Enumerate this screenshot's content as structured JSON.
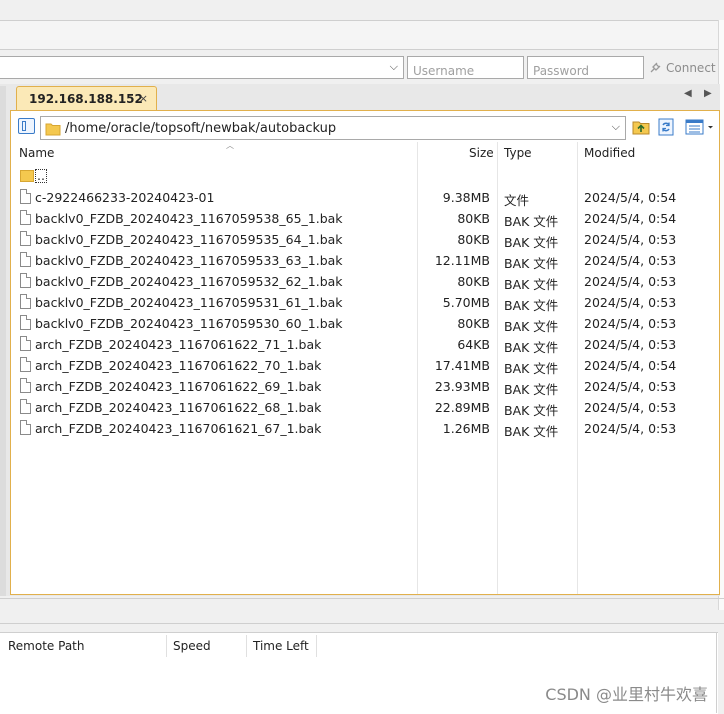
{
  "quickconnect": {
    "host_value": "",
    "username_placeholder": "Username",
    "password_placeholder": "Password",
    "connect_label": "Connect"
  },
  "tab": {
    "label": "192.168.188.152",
    "close_glyph": "×"
  },
  "nav": {
    "prev_glyph": "◀",
    "next_glyph": "▶"
  },
  "path": {
    "value": "/home/oracle/topsoft/newbak/autobackup"
  },
  "columns": {
    "name": "Name",
    "size": "Size",
    "type": "Type",
    "modified": "Modified"
  },
  "up_entry": {
    "label": ".."
  },
  "files": [
    {
      "name": "c-2922466233-20240423-01",
      "size": "9.38MB",
      "type": "文件",
      "modified": "2024/5/4, 0:54"
    },
    {
      "name": "backlv0_FZDB_20240423_1167059538_65_1.bak",
      "size": "80KB",
      "type": "BAK 文件",
      "modified": "2024/5/4, 0:54"
    },
    {
      "name": "backlv0_FZDB_20240423_1167059535_64_1.bak",
      "size": "80KB",
      "type": "BAK 文件",
      "modified": "2024/5/4, 0:53"
    },
    {
      "name": "backlv0_FZDB_20240423_1167059533_63_1.bak",
      "size": "12.11MB",
      "type": "BAK 文件",
      "modified": "2024/5/4, 0:53"
    },
    {
      "name": "backlv0_FZDB_20240423_1167059532_62_1.bak",
      "size": "80KB",
      "type": "BAK 文件",
      "modified": "2024/5/4, 0:53"
    },
    {
      "name": "backlv0_FZDB_20240423_1167059531_61_1.bak",
      "size": "5.70MB",
      "type": "BAK 文件",
      "modified": "2024/5/4, 0:53"
    },
    {
      "name": "backlv0_FZDB_20240423_1167059530_60_1.bak",
      "size": "80KB",
      "type": "BAK 文件",
      "modified": "2024/5/4, 0:53"
    },
    {
      "name": "arch_FZDB_20240423_1167061622_71_1.bak",
      "size": "64KB",
      "type": "BAK 文件",
      "modified": "2024/5/4, 0:53"
    },
    {
      "name": "arch_FZDB_20240423_1167061622_70_1.bak",
      "size": "17.41MB",
      "type": "BAK 文件",
      "modified": "2024/5/4, 0:54"
    },
    {
      "name": "arch_FZDB_20240423_1167061622_69_1.bak",
      "size": "23.93MB",
      "type": "BAK 文件",
      "modified": "2024/5/4, 0:53"
    },
    {
      "name": "arch_FZDB_20240423_1167061622_68_1.bak",
      "size": "22.89MB",
      "type": "BAK 文件",
      "modified": "2024/5/4, 0:53"
    },
    {
      "name": "arch_FZDB_20240423_1167061621_67_1.bak",
      "size": "1.26MB",
      "type": "BAK 文件",
      "modified": "2024/5/4, 0:53"
    }
  ],
  "queue_columns": {
    "remote_path": "Remote Path",
    "speed": "Speed",
    "time_left": "Time Left"
  },
  "watermark": "CSDN @业里村牛欢喜",
  "colors": {
    "tab_bg": "#fbe9b7",
    "tab_border": "#e1b04c",
    "folder": "#f4c84f",
    "link_blue": "#3a7bc8"
  },
  "icons": {
    "connect": "plug-icon",
    "folder": "folder-icon",
    "file": "file-icon",
    "parent_dir": "folder-up-icon",
    "refresh": "refresh-icon",
    "view": "view-list-icon"
  }
}
